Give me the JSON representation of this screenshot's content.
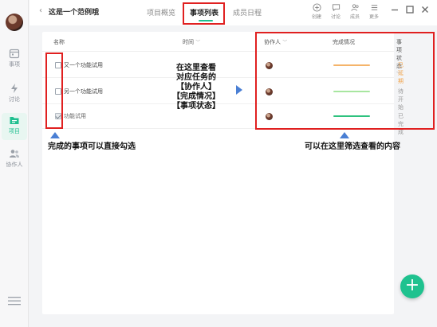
{
  "sidebar": {
    "items": [
      {
        "label": "事项",
        "icon": "calendar-icon"
      },
      {
        "label": "讨论",
        "icon": "lightning-icon"
      },
      {
        "label": "项目",
        "icon": "folder-icon",
        "active": true
      },
      {
        "label": "协作人",
        "icon": "people-icon"
      }
    ]
  },
  "header": {
    "back_icon": "chevron-left-icon",
    "title": "这是一个范例哦",
    "tabs": [
      {
        "label": "项目概览"
      },
      {
        "label": "事项列表",
        "active": true
      },
      {
        "label": "成员日程"
      }
    ],
    "tools": [
      {
        "label": "创建",
        "icon": "plus-circle-icon"
      },
      {
        "label": "讨论",
        "icon": "chat-icon"
      },
      {
        "label": "成员",
        "icon": "members-icon"
      },
      {
        "label": "更多",
        "icon": "menu-icon"
      }
    ]
  },
  "table": {
    "columns": {
      "name": "名称",
      "time": "时间",
      "assignee": "协作人",
      "progress": "完成情况",
      "status": "事项状态"
    },
    "rows": [
      {
        "name": "又一个功能试用",
        "checked": false,
        "progress": 0.5,
        "progress_color": "#f5b46a",
        "status": "已延期",
        "status_color": "#f2a44b"
      },
      {
        "name": "另一个功能试用",
        "checked": false,
        "progress": 0.0,
        "progress_color": "#a8e6a0",
        "status": "待开始",
        "status_color": "#999999"
      },
      {
        "name": "功能试用",
        "checked": true,
        "progress": 1.0,
        "progress_color": "#2ec27e",
        "status": "已完成",
        "status_color": "#999999"
      }
    ]
  },
  "annotations": {
    "middle": [
      "在这里查看",
      "对应任务的",
      "【协作人】",
      "【完成情况】",
      "【事项状态】"
    ],
    "left": "完成的事项可以直接勾选",
    "right": "可以在这里筛选查看的内容"
  },
  "colors": {
    "accent": "#1fbf8f",
    "annotation_red": "#e02020",
    "annotation_arrow": "#4a7fd4"
  }
}
